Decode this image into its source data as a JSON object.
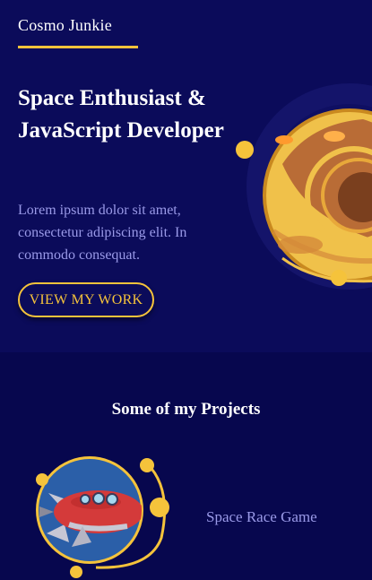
{
  "header": {
    "brand": "Cosmo Junkie"
  },
  "hero": {
    "headline": "Space Enthusiast & JavaScript Developer",
    "description": "Lorem ipsum dolor sit amet, consectetur adipiscing elit. In commodo consequat.",
    "cta_label": "VIEW MY WORK"
  },
  "projects": {
    "section_title": "Some of my Projects",
    "items": [
      {
        "title": "Space Race Game",
        "image_icon": "rocket-icon"
      }
    ]
  },
  "colors": {
    "hero_bg": "#0b0b5a",
    "page_bg": "#07074e",
    "accent": "#f5c33b",
    "muted_text": "#9a9ae8",
    "heading_text": "#ffffff"
  }
}
